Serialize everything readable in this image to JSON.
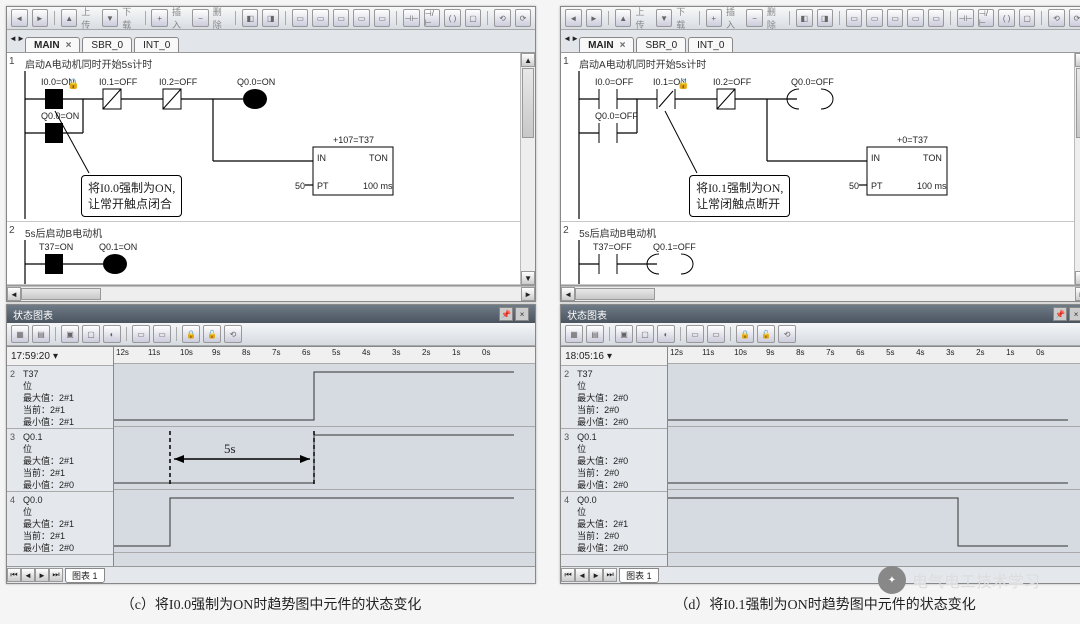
{
  "left": {
    "toolbar": {
      "upload": "上传",
      "download": "下载",
      "insert": "插入",
      "delete": "删除"
    },
    "tabs": [
      "MAIN",
      "SBR_0",
      "INT_0"
    ],
    "net1": {
      "title": "启动A电动机同时开始5s计时",
      "c1": "I0.0=ON",
      "c2": "I0.1=OFF",
      "c3": "I0.2=OFF",
      "out": "Q0.0=ON",
      "br": "Q0.0=ON",
      "timer_top": "+107=T37",
      "timer_in": "IN",
      "timer_ton": "TON",
      "timer_pt": "PT",
      "timer_pv": "50",
      "timer_ms": "100 ms"
    },
    "net2": {
      "title": "5s后启动B电动机",
      "c1": "T37=ON",
      "out": "Q0.1=ON"
    },
    "callout": {
      "l1": "将I0.0强制为ON,",
      "l2": "让常开触点闭合"
    },
    "status_title": "状态图表",
    "time": "17:59:20",
    "ruler": [
      "12s",
      "11s",
      "10s",
      "9s",
      "8s",
      "7s",
      "6s",
      "5s",
      "4s",
      "3s",
      "2s",
      "1s",
      "0s"
    ],
    "rows": [
      {
        "n": "2",
        "name": "T37",
        "bit": "位",
        "max": "最大值：2#1",
        "cur": "当前：2#1",
        "min": "最小值：2#1"
      },
      {
        "n": "3",
        "name": "Q0.1",
        "bit": "位",
        "max": "最大值：2#1",
        "cur": "当前：2#1",
        "min": "最小值：2#0"
      },
      {
        "n": "4",
        "name": "Q0.0",
        "bit": "位",
        "max": "最大值：2#1",
        "cur": "当前：2#1",
        "min": "最小值：2#0"
      }
    ],
    "five_s": "5s",
    "chart_tab": "图表 1",
    "caption": "（c）将I0.0强制为ON时趋势图中元件的状态变化",
    "chart_data": {
      "type": "line",
      "x_axis_seconds": [
        12,
        11,
        10,
        9,
        8,
        7,
        6,
        5,
        4,
        3,
        2,
        1,
        0
      ],
      "series": [
        {
          "name": "T37",
          "values_by_second": {
            "12": 0,
            "6": 1
          },
          "note": "rises at ~6s mark, stays high"
        },
        {
          "name": "Q0.1",
          "values_by_second": {
            "12": 0,
            "6": 1
          },
          "note": "rises with T37; 5s after Q0.0"
        },
        {
          "name": "Q0.0",
          "values_by_second": {
            "12": 0,
            "11": 1
          },
          "note": "rises near 11s mark, stays high"
        }
      ],
      "annotation": "5s interval between Q0.0 rising edge and Q0.1 rising edge"
    }
  },
  "right": {
    "toolbar": {
      "upload": "上传",
      "download": "下载",
      "insert": "插入",
      "delete": "删除"
    },
    "tabs": [
      "MAIN",
      "SBR_0",
      "INT_0"
    ],
    "net1": {
      "title": "启动A电动机同时开始5s计时",
      "c1": "I0.0=OFF",
      "c2": "I0.1=ON",
      "c3": "I0.2=OFF",
      "out": "Q0.0=OFF",
      "br": "Q0.0=OFF",
      "timer_top": "+0=T37",
      "timer_in": "IN",
      "timer_ton": "TON",
      "timer_pt": "PT",
      "timer_pv": "50",
      "timer_ms": "100 ms"
    },
    "net2": {
      "title": "5s后启动B电动机",
      "c1": "T37=OFF",
      "out": "Q0.1=OFF"
    },
    "callout": {
      "l1": "将I0.1强制为ON,",
      "l2": "让常闭触点断开"
    },
    "status_title": "状态图表",
    "time": "18:05:16",
    "ruler": [
      "12s",
      "11s",
      "10s",
      "9s",
      "8s",
      "7s",
      "6s",
      "5s",
      "4s",
      "3s",
      "2s",
      "1s",
      "0s"
    ],
    "rows": [
      {
        "n": "2",
        "name": "T37",
        "bit": "位",
        "max": "最大值：2#0",
        "cur": "当前：2#0",
        "min": "最小值：2#0"
      },
      {
        "n": "3",
        "name": "Q0.1",
        "bit": "位",
        "max": "最大值：2#0",
        "cur": "当前：2#0",
        "min": "最小值：2#0"
      },
      {
        "n": "4",
        "name": "Q0.0",
        "bit": "位",
        "max": "最大值：2#1",
        "cur": "当前：2#0",
        "min": "最小值：2#0"
      }
    ],
    "chart_tab": "图表 1",
    "caption": "（d）将I0.1强制为ON时趋势图中元件的状态变化",
    "chart_data": {
      "type": "line",
      "x_axis_seconds": [
        12,
        11,
        10,
        9,
        8,
        7,
        6,
        5,
        4,
        3,
        2,
        1,
        0
      ],
      "series": [
        {
          "name": "T37",
          "values_by_second": {
            "12": 0,
            "0": 0
          },
          "note": "flat low"
        },
        {
          "name": "Q0.1",
          "values_by_second": {
            "12": 0,
            "0": 0
          },
          "note": "flat low"
        },
        {
          "name": "Q0.0",
          "values_by_second": {
            "12": 1,
            "3": 0
          },
          "note": "high then drops to low around 3s mark"
        }
      ]
    }
  },
  "logo": "电气电工技术学习"
}
